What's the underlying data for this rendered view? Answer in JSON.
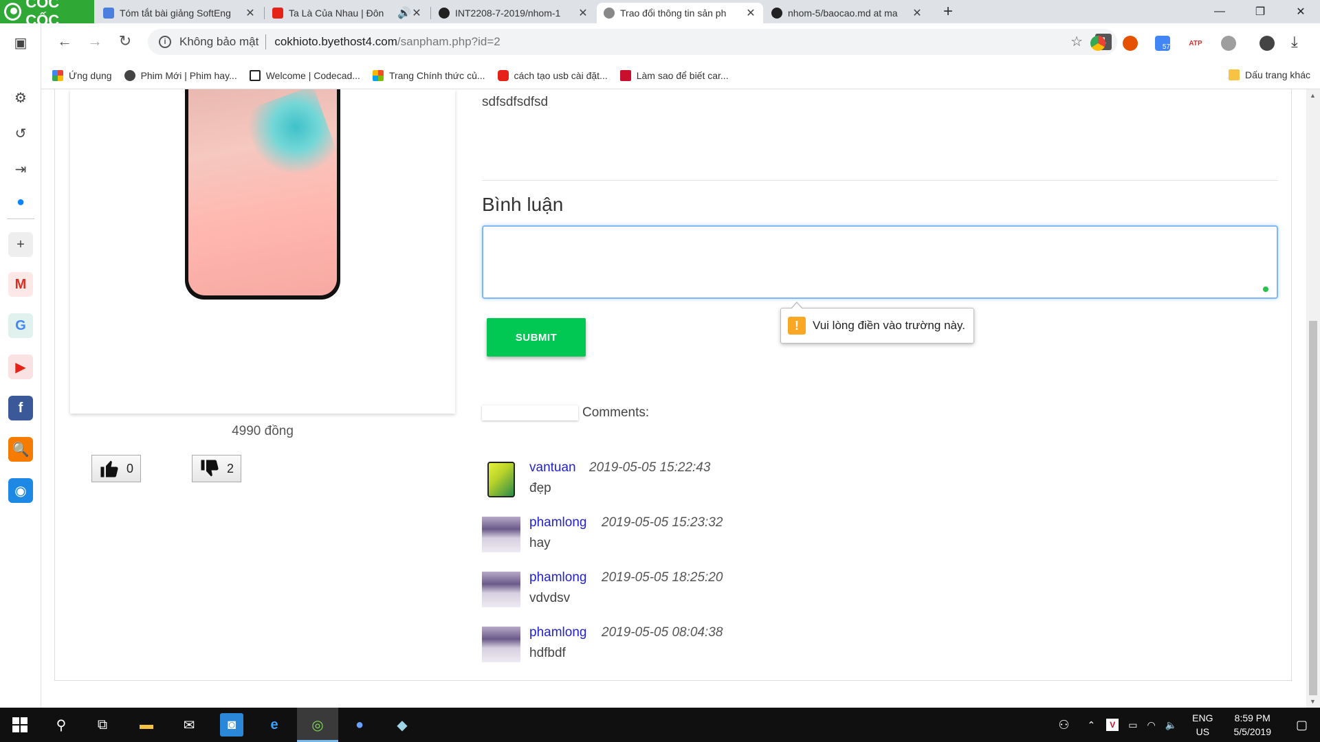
{
  "browser": {
    "brand": "CỐC CỐC",
    "tabs": [
      {
        "title": "Tóm tắt bài giảng SoftEng",
        "color": "#4a7fe0"
      },
      {
        "title": "Ta Là Của Nhau | Đôn",
        "color": "#e62117"
      },
      {
        "title": "INT2208-7-2019/nhom-1",
        "color": "#222222"
      },
      {
        "title": "Trao đổi thông tin sản ph",
        "color": "#666666"
      },
      {
        "title": "nhom-5/baocao.md at ma",
        "color": "#222222"
      }
    ],
    "new_tab": "+",
    "security_label": "Không bảo mật",
    "url_host": "cokhioto.byethost4.com",
    "url_path": "/sanpham.php?id=2",
    "bookmarks": [
      {
        "label": "Ứng dụng",
        "color": "#e04040"
      },
      {
        "label": "Phim Mới | Phim hay...",
        "color": "#444444"
      },
      {
        "label": "Welcome | Codecad...",
        "color": "#222222"
      },
      {
        "label": "Trang Chính thức củ...",
        "color": "#f25022"
      },
      {
        "label": "cách tạo usb cài đặt...",
        "color": "#e62117"
      },
      {
        "label": "Làm sao để biết car...",
        "color": "#c8102e"
      }
    ],
    "other_bookmarks": "Dấu trang khác",
    "ext_badge": "57",
    "atp_label": "ATP"
  },
  "product": {
    "description": "sdfsdfsdfsd",
    "price": "4990 đồng",
    "likes": "0",
    "dislikes": "2"
  },
  "comment_form": {
    "title": "Bình luận",
    "textarea_value": "",
    "submit_label": "SUBMIT",
    "validation_message": "Vui lòng điền vào trường này.",
    "validation_icon": "!"
  },
  "comments_label": "Comments:",
  "comments": [
    {
      "user": "vantuan",
      "time": "2019-05-05 15:22:43",
      "text": "đẹp"
    },
    {
      "user": "phamlong",
      "time": "2019-05-05 15:23:32",
      "text": "hay"
    },
    {
      "user": "phamlong",
      "time": "2019-05-05 18:25:20",
      "text": "vdvdsv"
    },
    {
      "user": "phamlong",
      "time": "2019-05-05 08:04:38",
      "text": "hdfbdf"
    }
  ],
  "taskbar": {
    "lang_line1": "ENG",
    "lang_line2": "US",
    "time": "8:59 PM",
    "date": "5/5/2019"
  },
  "colors": {
    "accent_green": "#00c853",
    "link_blue": "#2222cc",
    "brand_green": "#2fa836"
  }
}
